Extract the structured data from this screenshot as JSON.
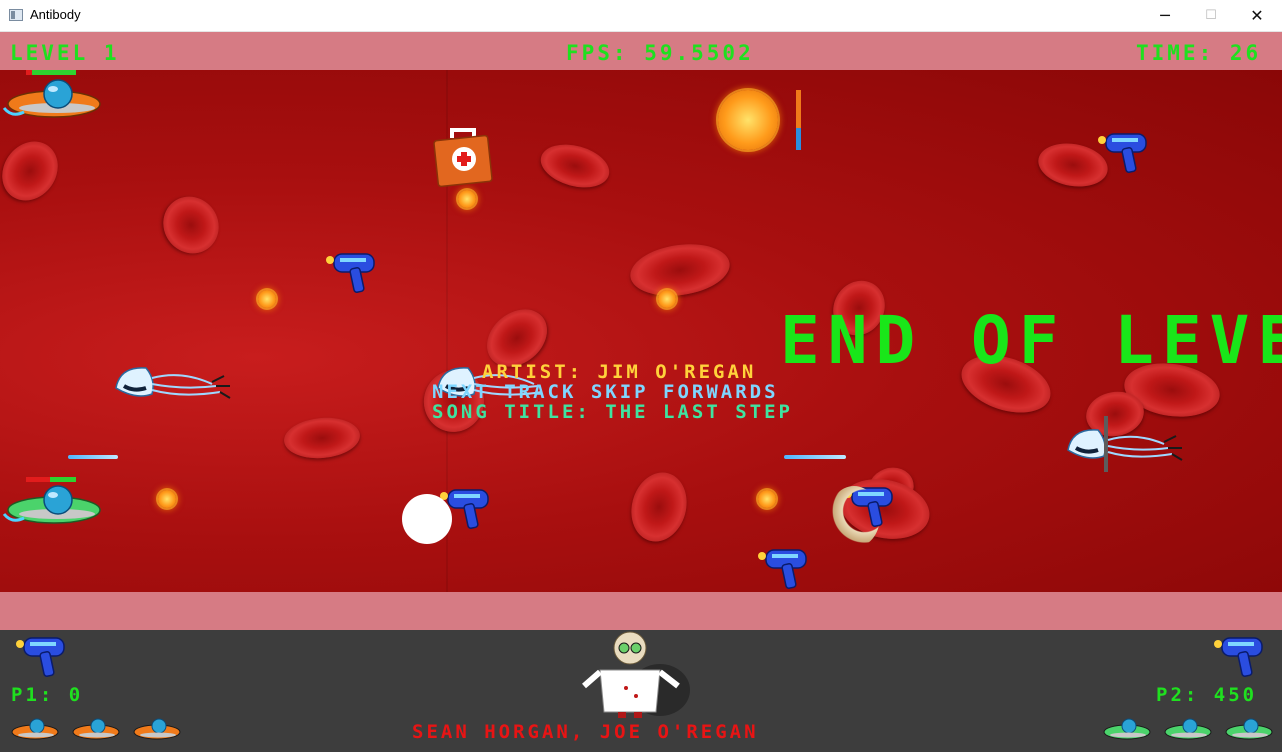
{
  "window": {
    "title": "Antibody",
    "minimize": "─",
    "maximize": "☐",
    "close": "✕"
  },
  "hud": {
    "level": "LEVEL 1",
    "fps": "FPS: 59.5502",
    "time": "TIME: 26"
  },
  "overlay": {
    "end_of_level": "END OF LEVE",
    "artist": "ARTIST: JIM O'REGAN",
    "track": "NEXT TRACK SKIP FORWARDS",
    "song": "SONG TITLE: THE LAST STEP"
  },
  "status": {
    "p1_score": "P1: 0",
    "p2_score": "P2: 450",
    "credits": "SEAN HORGAN, JOE O'REGAN",
    "p1_lives": 3,
    "p2_lives": 3
  },
  "colors": {
    "hud_text": "#1fe01f",
    "hud_bar": "#d67b84",
    "blood": "#b31212",
    "credits_text": "#e81414",
    "artist_text": "#ffd23b",
    "track_text": "#7fd6ff",
    "song_text": "#3fe3a0"
  }
}
